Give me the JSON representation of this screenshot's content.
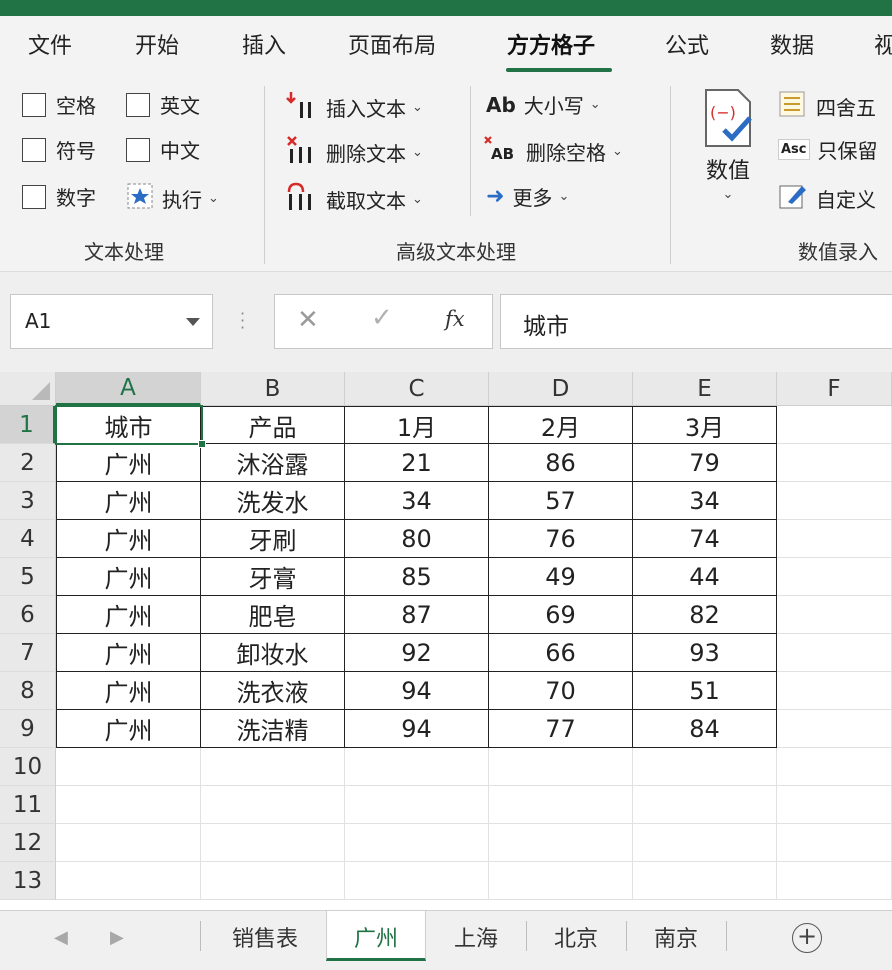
{
  "ribbon_tabs": [
    "文件",
    "开始",
    "插入",
    "页面布局",
    "方方格子",
    "公式",
    "数据",
    "视"
  ],
  "active_tab": "方方格子",
  "text_group": {
    "checkboxes": [
      "空格",
      "英文",
      "符号",
      "中文",
      "数字"
    ],
    "execute_label": "执行",
    "group_label": "文本处理"
  },
  "advanced_group": {
    "insert_text": "插入文本",
    "delete_text": "删除文本",
    "extract_text": "截取文本",
    "case_label": "大小写",
    "remove_spaces": "删除空格",
    "more_label": "更多",
    "group_label": "高级文本处理"
  },
  "value_group": {
    "value_button": "数值",
    "round_label": "四舍五",
    "keep_label": "只保留",
    "custom_label": "自定义",
    "group_label": "数值录入"
  },
  "formula_bar": {
    "name_box": "A1",
    "fx_symbol": "fx",
    "content": "城市"
  },
  "column_headers": [
    "A",
    "B",
    "C",
    "D",
    "E",
    "F"
  ],
  "row_headers": [
    "1",
    "2",
    "3",
    "4",
    "5",
    "6",
    "7",
    "8",
    "9",
    "10",
    "11",
    "12",
    "13"
  ],
  "table": {
    "header": [
      "城市",
      "产品",
      "1月",
      "2月",
      "3月"
    ],
    "rows": [
      [
        "广州",
        "沐浴露",
        "21",
        "86",
        "79"
      ],
      [
        "广州",
        "洗发水",
        "34",
        "57",
        "34"
      ],
      [
        "广州",
        "牙刷",
        "80",
        "76",
        "74"
      ],
      [
        "广州",
        "牙膏",
        "85",
        "49",
        "44"
      ],
      [
        "广州",
        "肥皂",
        "87",
        "69",
        "82"
      ],
      [
        "广州",
        "卸妆水",
        "92",
        "66",
        "93"
      ],
      [
        "广州",
        "洗衣液",
        "94",
        "70",
        "51"
      ],
      [
        "广州",
        "洗洁精",
        "94",
        "77",
        "84"
      ]
    ]
  },
  "sheet_tabs": [
    "销售表",
    "广州",
    "上海",
    "北京",
    "南京"
  ],
  "active_sheet": "广州",
  "colors": {
    "accent": "#217346",
    "ribbon_bg": "#f3f3f3"
  }
}
